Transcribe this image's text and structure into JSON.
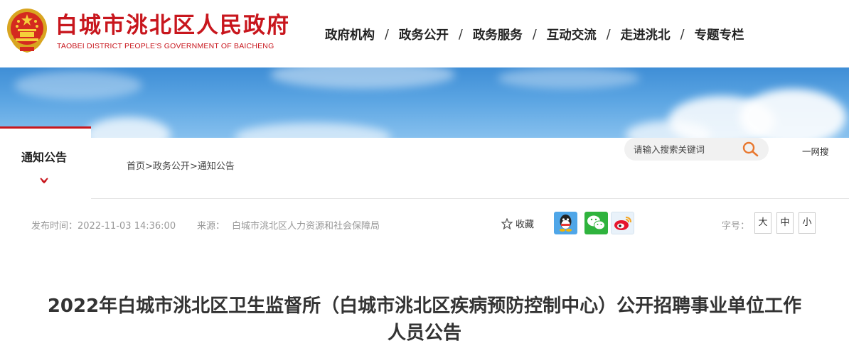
{
  "header": {
    "title": "白城市洮北区人民政府",
    "subtitle": "TAOBEI DISTRICT PEOPLE'S GOVERNMENT OF BAICHENG",
    "emblem_icon": "national-emblem-icon",
    "brand_color": "#c8161d"
  },
  "nav": {
    "items": [
      "政府机构",
      "政务公开",
      "政务服务",
      "互动交流",
      "走进洮北",
      "专题专栏"
    ],
    "separator": "/"
  },
  "section_tab": {
    "label": "通知公告",
    "caret_icon": "caret-down-icon"
  },
  "breadcrumb": {
    "items": [
      "首页",
      "政务公开",
      "通知公告"
    ],
    "separator": ">"
  },
  "search": {
    "placeholder": "请输入搜索关键词",
    "icon": "search-icon",
    "engine_label": "一网搜"
  },
  "meta": {
    "pubtime_label": "发布时间：",
    "pubtime_value": "2022-11-03 14:36:00",
    "source_label": "来源：",
    "source_value": "白城市洮北区人力资源和社会保障局",
    "favorite_label": "收藏",
    "share_icons": [
      "qq-icon",
      "wechat-icon",
      "weibo-icon"
    ],
    "fontsize_label": "字号：",
    "fontsize_options": [
      "大",
      "中",
      "小"
    ]
  },
  "article": {
    "title": "2022年白城市洮北区卫生监督所（白城市洮北区疾病预防控制中心）公开招聘事业单位工作人员公告"
  }
}
